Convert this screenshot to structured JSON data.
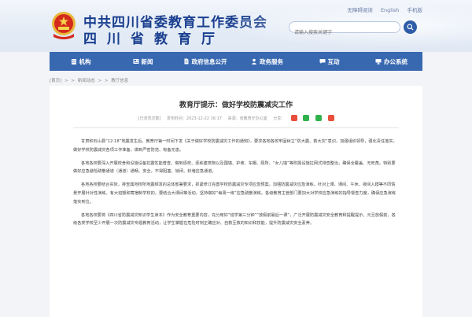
{
  "header": {
    "org_name": "中共四川省委教育工作委员会",
    "dept_name": "四川省教育厅",
    "top_links": [
      "无障碍阅读",
      "English",
      "手机版"
    ],
    "search_placeholder": "请输入搜索关键字"
  },
  "nav": [
    {
      "label": "机构",
      "icon": "building-icon"
    },
    {
      "label": "新闻",
      "icon": "newspaper-icon"
    },
    {
      "label": "政府信息公开",
      "icon": "document-icon"
    },
    {
      "label": "政务服务",
      "icon": "service-icon"
    },
    {
      "label": "互动",
      "icon": "chat-icon"
    },
    {
      "label": "办公系统",
      "icon": "computer-icon"
    }
  ],
  "breadcrumb": [
    "[首页]",
    ">",
    ">",
    "新闻动态",
    ">",
    ">",
    "教厅信息"
  ],
  "article": {
    "title": "教育厅提示：做好学校防震减灾工作",
    "meta_views": "[已浏览次数]",
    "meta_date": "发布时间：2023-12-22 16:17",
    "meta_source": "来源：省教育厅办公室",
    "meta_share": "分享：",
    "paragraphs": [
      "甘肃积石山县“12·18”地震发生后，教育厅第一时间下发《关于做好学校防震减灾工作的通知》，要求各地各校牢固树立“防大震、救大灾”意识，加强组织领导，强化责任落实，做好学校防震减灾各项工作准备，做到严密防范、有备无患。",
      "各地各校要深入开展校舍和设施设备抗震性能普查，做到逐校、逐栋建筑物以及围墙、护坡、车棚、厕所、“女儿墙”等附属设施拉网式排查整治，确保全覆盖、无死角。特别要做好应急避险疏散通道（通道）通畅、安全，不得阻塞、锁闭、封堵应急通道。",
      "各地各校要结合实际，排查属地校所地震频发的总体部署要求，抓紧修订完善学校防震减灾专项应急预案，加强防震减灾应急演练，针对上课、课间、午休、夜间入寝等不同情景开展针对性演练。有大班额和寄宿制学校的，要结合大课间等活动，坚持做好“每周一练”应急疏散演练。各级教育主管部门要加大对学校应急演练的指导督查力度，确保应急演练落实到位。",
      "各地各校要将《四川省防震减灾知识学生读本》作为安全教育重要内容，充分用好“班学第三分钟”“放假前最后一课”，广泛开展防震减灾安全教育和提醒提示。元旦放假前，各级各类学校至少开展一次防震减灾专题教育活动，让学生掌握在危险时刻正确应对、自救互救的知识和技能，提升防震减灾安全素养。"
    ]
  },
  "colors": {
    "nav_bg": "#3868b0",
    "title_blue": "#1a3f8f",
    "page_bg": "#f3f4f7"
  }
}
